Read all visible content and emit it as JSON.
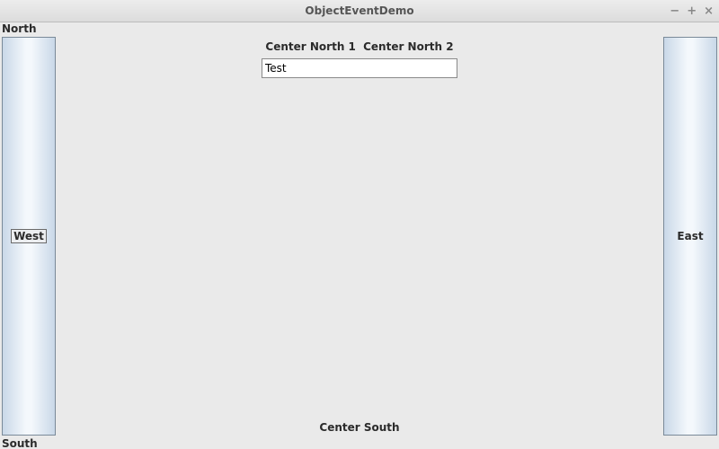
{
  "window": {
    "title": "ObjectEventDemo"
  },
  "labels": {
    "north": "North",
    "south": "South",
    "west": "West",
    "east": "East",
    "center_north_1": "Center North 1",
    "center_north_2": "Center North 2",
    "center_south": "Center South"
  },
  "input": {
    "value": "Test"
  },
  "win_controls": {
    "minimize": "−",
    "maximize": "+",
    "close": "×"
  }
}
